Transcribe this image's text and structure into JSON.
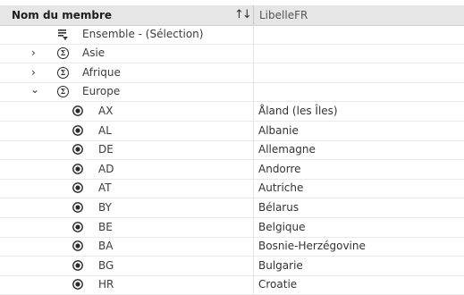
{
  "header": {
    "member_name": "Nom du membre",
    "libelle": "LibelleFR",
    "sort_icon": "sort-arrows-icon"
  },
  "rows": {
    "ensemble": {
      "name": "Ensemble - (Sélection)",
      "icon": "filter-set-icon"
    },
    "asie": {
      "name": "Asie",
      "icon": "sigma-icon",
      "expanded": false
    },
    "afrique": {
      "name": "Afrique",
      "icon": "sigma-icon",
      "expanded": false
    },
    "europe": {
      "name": "Europe",
      "icon": "sigma-icon",
      "expanded": true
    }
  },
  "members": [
    {
      "code": "AX",
      "label": "Åland (les Îles)"
    },
    {
      "code": "AL",
      "label": "Albanie"
    },
    {
      "code": "DE",
      "label": "Allemagne"
    },
    {
      "code": "AD",
      "label": "Andorre"
    },
    {
      "code": "AT",
      "label": "Autriche"
    },
    {
      "code": "BY",
      "label": "Bélarus"
    },
    {
      "code": "BE",
      "label": "Belgique"
    },
    {
      "code": "BA",
      "label": "Bosnie-Herzégovine"
    },
    {
      "code": "BG",
      "label": "Bulgarie"
    },
    {
      "code": "HR",
      "label": "Croatie"
    }
  ]
}
